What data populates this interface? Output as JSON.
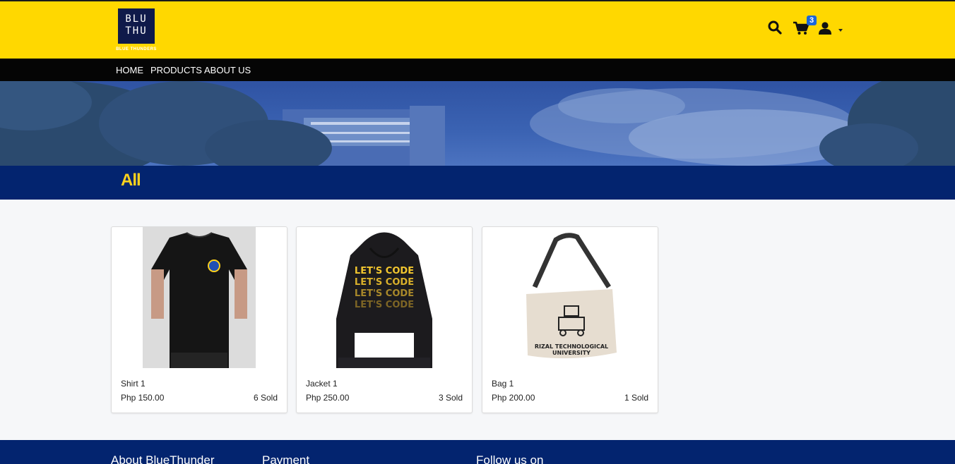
{
  "brand": {
    "logo_text": "BLU\nTHU",
    "logo_sub": "BLUE THUNDERS",
    "colors": {
      "header": "#ffd800",
      "nav": "#050505",
      "band": "#03246f",
      "accent": "#ffd21c"
    }
  },
  "header": {
    "icons": [
      "search-icon",
      "cart-icon",
      "user-icon"
    ],
    "cart_count": "3"
  },
  "nav": {
    "items": [
      {
        "label": "HOME"
      },
      {
        "label": "PRODUCTS"
      },
      {
        "label": "ABOUT US"
      }
    ]
  },
  "category": {
    "title": "All"
  },
  "products": [
    {
      "name": "Shirt 1",
      "price": "Php 150.00",
      "sold": "6 Sold"
    },
    {
      "name": "Jacket 1",
      "price": "Php 250.00",
      "sold": "3 Sold"
    },
    {
      "name": "Bag 1",
      "price": "Php 200.00",
      "sold": "1 Sold"
    }
  ],
  "hoodie_print": "LET'S CODE",
  "bag_print": {
    "line1": "RIZAL TECHNOLOGICAL",
    "line2": "UNIVERSITY"
  },
  "footer": {
    "headings": [
      {
        "label": "About BlueThunder"
      },
      {
        "label": "Payment"
      },
      {
        "label": "Follow us on"
      }
    ]
  }
}
